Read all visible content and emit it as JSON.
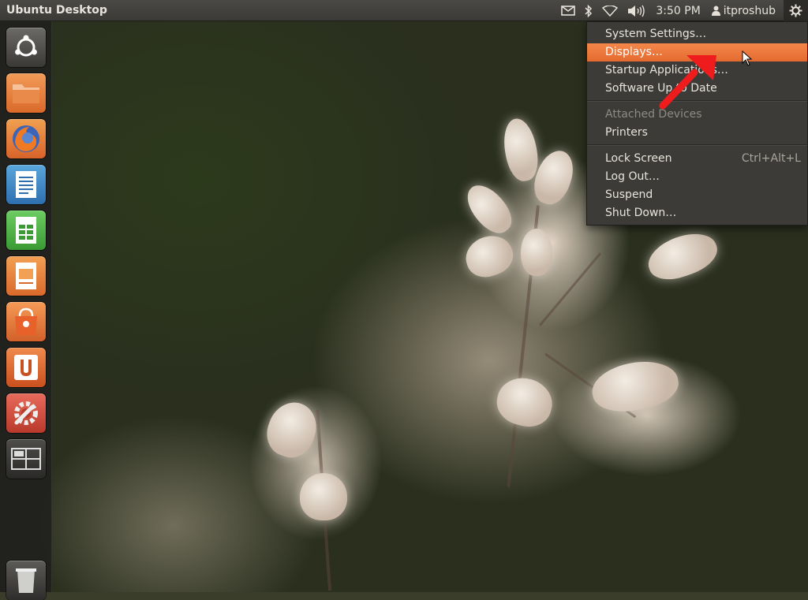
{
  "panel": {
    "app_title": "Ubuntu Desktop",
    "clock": "3:50 PM",
    "user": "itproshub",
    "icons": [
      "mail-icon",
      "bluetooth-icon",
      "network-icon",
      "volume-icon",
      "user-icon",
      "session-gear-icon"
    ]
  },
  "launcher": {
    "items": [
      {
        "name": "dash-home",
        "icon": "ubuntu-logo-icon"
      },
      {
        "name": "files",
        "icon": "folder-icon"
      },
      {
        "name": "firefox",
        "icon": "firefox-icon"
      },
      {
        "name": "libreoffice-writer",
        "icon": "writer-icon"
      },
      {
        "name": "libreoffice-calc",
        "icon": "calc-icon"
      },
      {
        "name": "libreoffice-impress",
        "icon": "impress-icon"
      },
      {
        "name": "software-center",
        "icon": "shopping-bag-icon"
      },
      {
        "name": "ubuntu-one",
        "icon": "ubuntu-one-icon"
      },
      {
        "name": "system-settings",
        "icon": "wrench-gear-icon"
      },
      {
        "name": "workspace-switcher",
        "icon": "workspaces-icon"
      },
      {
        "name": "trash",
        "icon": "trash-icon"
      }
    ]
  },
  "menu": {
    "system_settings": "System Settings…",
    "displays": "Displays…",
    "startup_apps": "Startup Applications…",
    "software_update": "Software Up to Date",
    "attached_devices": "Attached Devices",
    "printers": "Printers",
    "lock_screen": "Lock Screen",
    "lock_accel": "Ctrl+Alt+L",
    "log_out": "Log Out…",
    "suspend": "Suspend",
    "shut_down": "Shut Down…"
  },
  "colors": {
    "highlight": "#e46a2f",
    "panel_bg": "#3c3b37",
    "annotation_arrow": "#ee1c1c"
  }
}
